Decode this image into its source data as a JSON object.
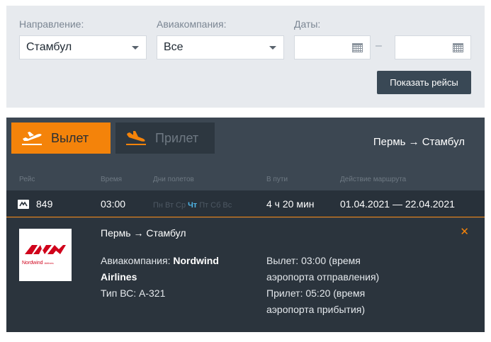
{
  "filters": {
    "direction_label": "Направление:",
    "direction_value": "Стамбул",
    "airline_label": "Авиакомпания:",
    "airline_value": "Все",
    "dates_label": "Даты:",
    "date_from": "",
    "date_to": "",
    "dash": "–",
    "show_button": "Показать рейсы"
  },
  "tabs": {
    "departure": "Вылет",
    "arrival": "Прилет"
  },
  "route_title": "Пермь → Стамбул",
  "columns": {
    "flight": "Рейс",
    "time": "Время",
    "days": "Дни полетов",
    "duration": "В пути",
    "validity": "Действие маршрута"
  },
  "flight": {
    "number": "849",
    "time": "03:00",
    "days": [
      "Пн",
      "Вт",
      "Ср",
      "Чт",
      "Пт",
      "Сб",
      "Вс"
    ],
    "active_day": "Чт",
    "duration": "4 ч 20 мин",
    "validity": "01.04.2021 — 22.04.2021"
  },
  "detail": {
    "route": "Пермь → Стамбул",
    "airline_label": "Авиакомпания:",
    "airline_name": "Nordwind Airlines",
    "aircraft": "Тип ВС: А-321",
    "departure_info": "Вылет: 03:00 (время аэропорта отправления)",
    "arrival_info": "Прилет: 05:20 (время аэропорта прибытия)",
    "logo_text": "Nordwind",
    "logo_subtext": "Airlines"
  },
  "colors": {
    "accent": "#f4830a",
    "panel": "#3c4752",
    "active_day": "#4fb6e8"
  }
}
